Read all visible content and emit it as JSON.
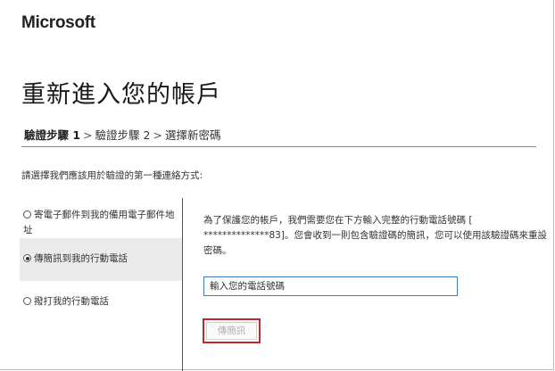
{
  "header": {
    "logo_text": "Microsoft"
  },
  "page_title": "重新進入您的帳戶",
  "steps": {
    "step1": "驗證步驟 1",
    "sep1": ">",
    "step2": "驗證步驟 2",
    "sep2": ">",
    "step3": "選擇新密碼"
  },
  "prompt": "請選擇我們應該用於驗證的第一種連絡方式:",
  "options": [
    {
      "label": "寄電子郵件到我的備用電子郵件地址",
      "selected": false
    },
    {
      "label": "傳簡訊到我的行動電話",
      "selected": true
    },
    {
      "label": "撥打我的行動電話",
      "selected": false
    }
  ],
  "detail": {
    "info": "為了保護您的帳戶，我們需要您在下方輸入完整的行動電話號碼 [ **************83]。您會收到一則包含驗證碼的簡訊，您可以使用該驗證碼來重設密碼。",
    "phone_placeholder": "輸入您的電話號碼",
    "send_button": "傳簡訊"
  },
  "colors": {
    "input_border": "#3f7fbf",
    "button_highlight": "#c0272d",
    "selected_option_bg": "#ebebeb"
  }
}
